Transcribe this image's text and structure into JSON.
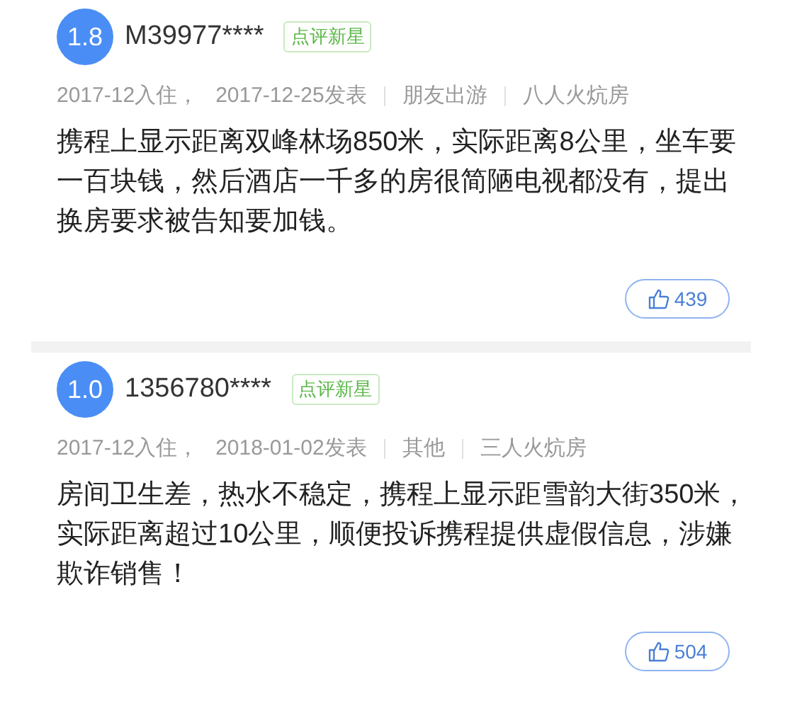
{
  "reviews": [
    {
      "score": "1.8",
      "user": "M39977****",
      "badge": "点评新星",
      "checkin": "2017-12入住，",
      "posted": "2017-12-25发表",
      "trip": "朋友出游",
      "room": "八人火炕房",
      "text": "携程上显示距离双峰林场850米，实际距离8公里，坐车要一百块钱，然后酒店一千多的房很简陋电视都没有，提出换房要求被告知要加钱。",
      "likes": "439"
    },
    {
      "score": "1.0",
      "user": "1356780****",
      "badge": "点评新星",
      "checkin": "2017-12入住，",
      "posted": "2018-01-02发表",
      "trip": "其他",
      "room": "三人火炕房",
      "text": "房间卫生差，热水不稳定，携程上显示距雪韵大街350米，实际距离超过10公里，顺便投诉携程提供虚假信息，涉嫌欺诈销售！",
      "likes": "504"
    }
  ]
}
